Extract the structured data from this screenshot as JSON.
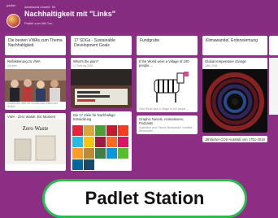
{
  "header": {
    "brand": "padlet",
    "breadcrumb": "Arbeitskreis Umwelt · 5h",
    "title": "Nachhaltigkeit mit \"Links\"",
    "subtitle": "Padlet zum Mit-Tun"
  },
  "columns": [
    {
      "title": "Die besten VWAs zum Thema Nachhaltigkeit",
      "cards": [
        {
          "title": "Reflektierung zu VWA",
          "subtitle": "Die Idee ..."
        },
        {
          "title": "Kurzbericht über die Klimaschutz-Aktion der Schule",
          "subtitle": ""
        },
        {
          "title": "VWA - Zero Waste: Ein Moment",
          "subtitle": "Zero Waste"
        }
      ]
    },
    {
      "title": "17 SDGs - Sustainable Development Goals",
      "cards": [
        {
          "title": "What's the plan?",
          "subtitle": "17 Ziele bis 2030"
        },
        {
          "title": "Die 17 Ziele für Nachhaltige Entwicklung",
          "subtitle": ""
        }
      ]
    },
    {
      "title": "Fundgrube",
      "cards": [
        {
          "title": "If the World were a Village of 100 people ...",
          "subtitle": "If the World were a Village of 100 people ..."
        },
        {
          "title": "Graphic Novels, Animationen, Podcasts",
          "subtitle": "Sachbilder zum Thema Klimawandel, Konflikte, Ressourcen ..."
        }
      ]
    },
    {
      "title": "Klimawandel, Erderwärmung",
      "cards": [
        {
          "title": "Global temperature change",
          "subtitle": "1850-2018"
        },
        {
          "title": "Jährlicher CO2-Ausstoß von 1751-2018",
          "subtitle": ""
        }
      ]
    }
  ],
  "cta": {
    "label": "Padlet Station"
  },
  "colors": {
    "background": "#8b2e84",
    "cta_border": "#28bd50"
  }
}
